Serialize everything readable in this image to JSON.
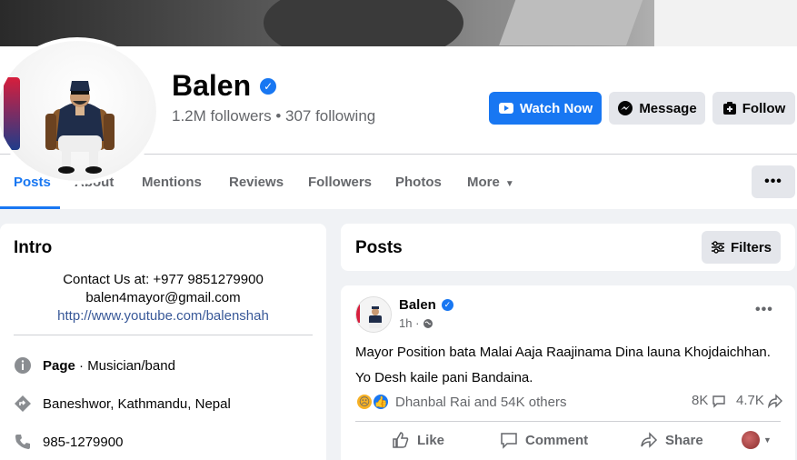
{
  "profile": {
    "name": "Balen",
    "stats": "1.2M followers • 307 following"
  },
  "actions": {
    "watch_label": "Watch Now",
    "message_label": "Message",
    "follow_label": "Follow"
  },
  "tabs": [
    "Posts",
    "About",
    "Mentions",
    "Reviews",
    "Followers",
    "Photos",
    "More"
  ],
  "intro": {
    "title": "Intro",
    "bio_line1": "Contact Us at: +977 9851279900",
    "bio_line2": "balen4mayor@gmail.com",
    "bio_link": "http://www.youtube.com/balenshah",
    "page_label": "Page",
    "page_category": " · Musician/band",
    "location": "Baneshwor, Kathmandu, Nepal",
    "phone": "985-1279900"
  },
  "posts_section": {
    "title": "Posts",
    "filters_label": "Filters"
  },
  "post": {
    "author": "Balen",
    "time": "1h ·",
    "line1": "Mayor Position bata Malai Aaja Raajinama Dina launa Khojdaichhan.",
    "line2": "Yo Desh kaile pani Bandaina.",
    "reactions_text": "Dhanbal Rai and 54K others",
    "comments_count": "8K",
    "shares_count": "4.7K",
    "like_label": "Like",
    "comment_label": "Comment",
    "share_label": "Share"
  },
  "colors": {
    "accent": "#1877f2",
    "secondary_button": "#e4e6eb",
    "page_bg": "#f0f2f5",
    "muted_text": "#65676b"
  },
  "icons": [
    "verified-badge-icon",
    "video-icon",
    "messenger-icon",
    "follow-icon",
    "more-dots-icon",
    "filters-icon",
    "info-icon",
    "location-icon",
    "phone-icon",
    "globe-icon",
    "like-icon",
    "comment-icon",
    "share-icon",
    "sad-reaction-icon",
    "like-reaction-icon"
  ]
}
